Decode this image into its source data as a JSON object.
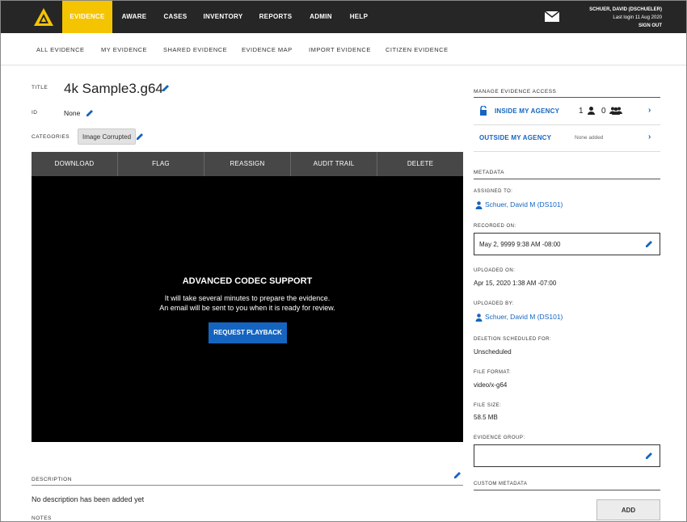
{
  "nav": {
    "items": [
      "EVIDENCE",
      "AWARE",
      "CASES",
      "INVENTORY",
      "REPORTS",
      "ADMIN",
      "HELP"
    ],
    "active": "EVIDENCE",
    "accent": "#f5c400"
  },
  "user": {
    "name": "SCHUER, DAVID (DSCHUELER)",
    "last_login": "Last login 11 Aug 2020",
    "sign_out": "SIGN OUT"
  },
  "subnav": [
    "ALL EVIDENCE",
    "MY EVIDENCE",
    "SHARED EVIDENCE",
    "EVIDENCE MAP",
    "IMPORT EVIDENCE",
    "CITIZEN EVIDENCE"
  ],
  "evidence": {
    "title_label": "TITLE",
    "title": "4k Sample3.g64",
    "id_label": "ID",
    "id": "None",
    "categories_label": "CATEGORIES",
    "category": "Image Corrupted"
  },
  "actions": [
    "DOWNLOAD",
    "FLAG",
    "REASSIGN",
    "AUDIT TRAIL",
    "DELETE"
  ],
  "player": {
    "title": "ADVANCED CODEC SUPPORT",
    "line1": "It will take several minutes to prepare the evidence.",
    "line2": "An email will be sent to you when it is ready for review.",
    "button": "REQUEST PLAYBACK"
  },
  "description": {
    "label": "DESCRIPTION",
    "value": "No description has been added yet",
    "notes_label": "NOTES"
  },
  "access": {
    "heading": "MANAGE EVIDENCE ACCESS",
    "inside": "INSIDE MY AGENCY",
    "user_count": "1",
    "group_count": "0",
    "outside": "OUTSIDE MY AGENCY",
    "outside_status": "None added"
  },
  "metadata": {
    "heading": "METADATA",
    "assigned_label": "ASSIGNED TO:",
    "assigned": "Schuer, David M (DS101)",
    "recorded_label": "RECORDED ON:",
    "recorded": "May 2, 9999 9:38 AM -08:00",
    "uploaded_label": "UPLOADED ON:",
    "uploaded": "Apr 15, 2020 1:38 AM -07:00",
    "uploaded_by_label": "UPLOADED BY:",
    "uploaded_by": "Schuer, David M (DS101)",
    "deletion_label": "DELETION SCHEDULED FOR:",
    "deletion": "Unscheduled",
    "format_label": "FILE FORMAT:",
    "format": "video/x-g64",
    "size_label": "FILE SIZE:",
    "size": "58.5 MB",
    "group_label": "EVIDENCE GROUP:",
    "group": "",
    "custom_label": "CUSTOM METADATA",
    "add_button": "ADD"
  }
}
